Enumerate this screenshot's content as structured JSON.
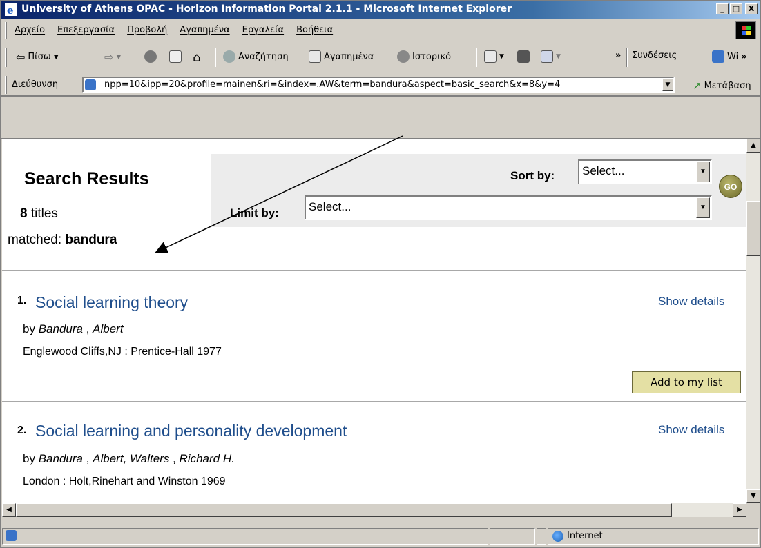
{
  "window": {
    "title": "University of Athens OPAC - Horizon Information Portal 2.1.1 - Microsoft Internet Explorer",
    "min_glyph": "_",
    "max_glyph": "□",
    "close_glyph": "X"
  },
  "menu": {
    "items": [
      "Αρχείο",
      "Επεξεργασία",
      "Προβολή",
      "Αγαπημένα",
      "Εργαλεία",
      "Βοήθεια"
    ]
  },
  "toolbar": {
    "back_label": "Πίσω",
    "search_label": "Αναζήτηση",
    "favorites_label": "Αγαπημένα",
    "history_label": "Ιστορικό",
    "links_label": "Συνδέσεις",
    "wi_label": "Wi",
    "chevron": "»"
  },
  "address": {
    "label": "Διεύθυνση",
    "value": "npp=10&ipp=20&profile=mainen&ri=&index=.AW&term=bandura&aspect=basic_search&x=8&y=4",
    "go_label": "Μετάβαση"
  },
  "page": {
    "heading": "Search Results",
    "count_num": "8",
    "count_text": "titles",
    "matched_label": "matched:",
    "matched_term": "bandura",
    "sort_label": "Sort by:",
    "sort_value": "Select...",
    "limit_label": "Limit by:",
    "limit_value": "Select...",
    "go_label": "GO"
  },
  "results": [
    {
      "num": "1.",
      "title": "Social learning theory",
      "details": "Show details",
      "by_prefix": "by",
      "author1_last": "Bandura",
      "author1_first": "Albert",
      "pub": "Englewood Cliffs,NJ : Prentice-Hall 1977",
      "add_label": "Add to my list"
    },
    {
      "num": "2.",
      "title": "Social learning and personality development",
      "details": "Show details",
      "by_prefix": "by",
      "author1_last": "Bandura",
      "author1_first": "Albert,",
      "author2_last": "Walters",
      "author2_first": "Richard H.",
      "pub": "London : Holt,Rinehart and Winston 1969"
    }
  ],
  "status": {
    "zone": "Internet"
  }
}
